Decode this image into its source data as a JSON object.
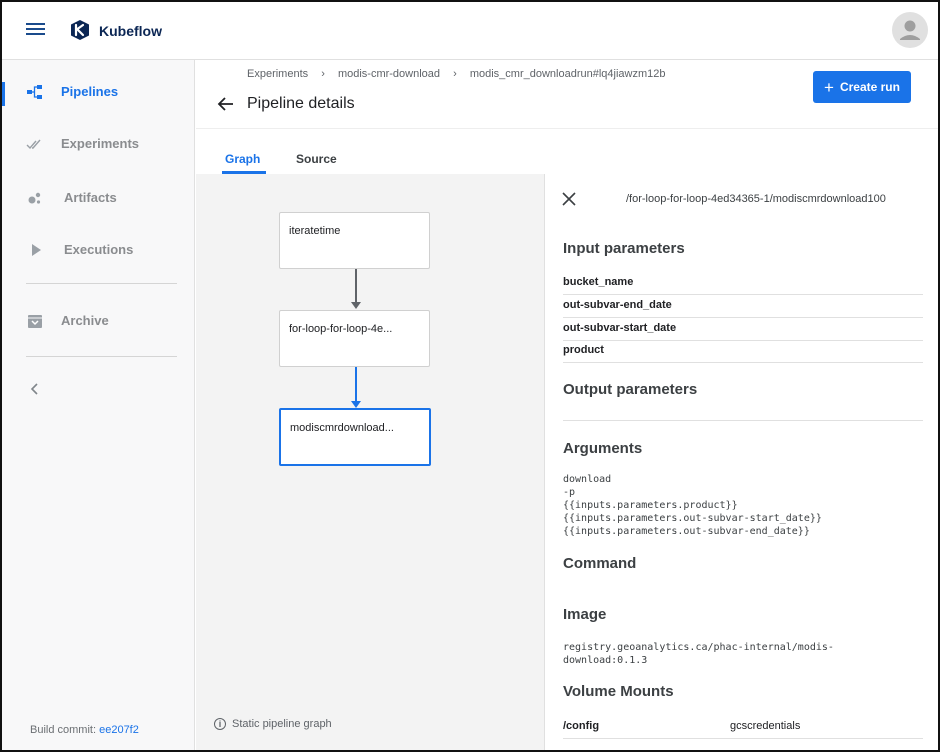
{
  "app": {
    "brand": "Kubeflow"
  },
  "sidebar": {
    "items": [
      {
        "label": "Pipelines",
        "active": true
      },
      {
        "label": "Experiments",
        "active": false
      },
      {
        "label": "Artifacts",
        "active": false
      },
      {
        "label": "Executions",
        "active": false
      },
      {
        "label": "Archive",
        "active": false
      }
    ],
    "build_label": "Build commit:",
    "build_commit": "ee207f2"
  },
  "header": {
    "breadcrumbs": [
      "Experiments",
      "modis-cmr-download",
      "modis_cmr_downloadrun#lq4jiawzm12b"
    ],
    "breadcrumb_separator": "›",
    "title": "Pipeline details",
    "create_run_label": "Create run"
  },
  "tabs": [
    {
      "label": "Graph",
      "active": true
    },
    {
      "label": "Source",
      "active": false
    }
  ],
  "graph": {
    "nodes": [
      {
        "label": "iteratetime"
      },
      {
        "label": "for-loop-for-loop-4e..."
      },
      {
        "label": "modiscmrdownload..."
      }
    ],
    "static_note": "Static pipeline graph"
  },
  "details": {
    "node_path": "/for-loop-for-loop-4ed34365-1/modiscmrdownload100",
    "input_title": "Input parameters",
    "input_params": [
      {
        "name": "bucket_name",
        "value": ""
      },
      {
        "name": "out-subvar-end_date",
        "value": ""
      },
      {
        "name": "out-subvar-start_date",
        "value": ""
      },
      {
        "name": "product",
        "value": ""
      }
    ],
    "output_title": "Output parameters",
    "arguments_title": "Arguments",
    "arguments": [
      "download",
      "-p",
      "{{inputs.parameters.product}}",
      "{{inputs.parameters.out-subvar-start_date}}",
      "{{inputs.parameters.out-subvar-end_date}}"
    ],
    "command_title": "Command",
    "image_title": "Image",
    "image_lines": [
      "registry.geoanalytics.ca/phac-internal/modis-",
      "download:0.1.3"
    ],
    "volume_title": "Volume Mounts",
    "volume_mounts": [
      {
        "path": "/config",
        "name": "gcscredentials"
      }
    ]
  },
  "colors": {
    "accent": "#1a73e8",
    "brand_dark": "#0b2654"
  }
}
